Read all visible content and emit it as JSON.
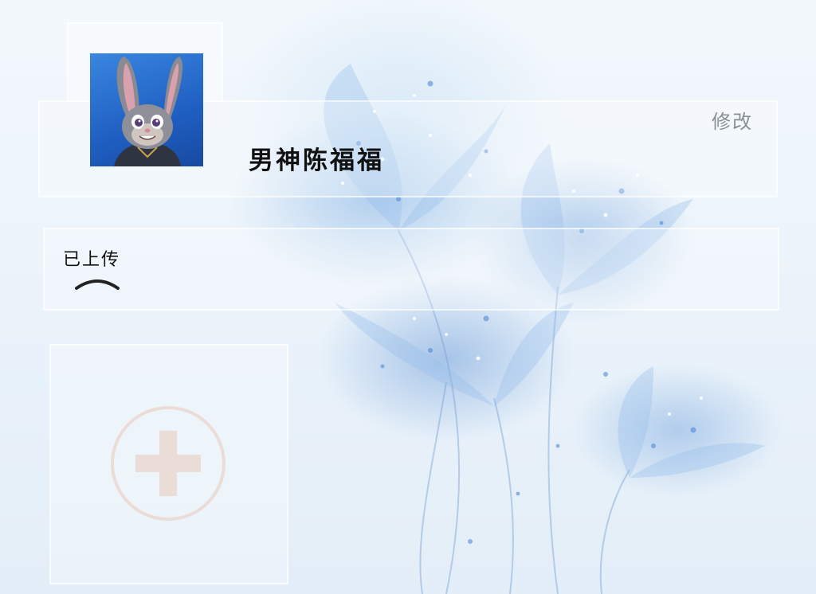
{
  "profile": {
    "username": "男神陈福福",
    "edit_label": "修改",
    "avatar_icon": "rabbit-avatar"
  },
  "uploads": {
    "label": "已上传",
    "toggle_icon": "chevron-up-icon"
  },
  "add": {
    "icon": "plus-circle-icon"
  },
  "colors": {
    "background": "#eef4fa",
    "flower_blue": "#6fa3e0",
    "edit_text": "#8a8f96",
    "add_icon": "#e8dcd8"
  }
}
